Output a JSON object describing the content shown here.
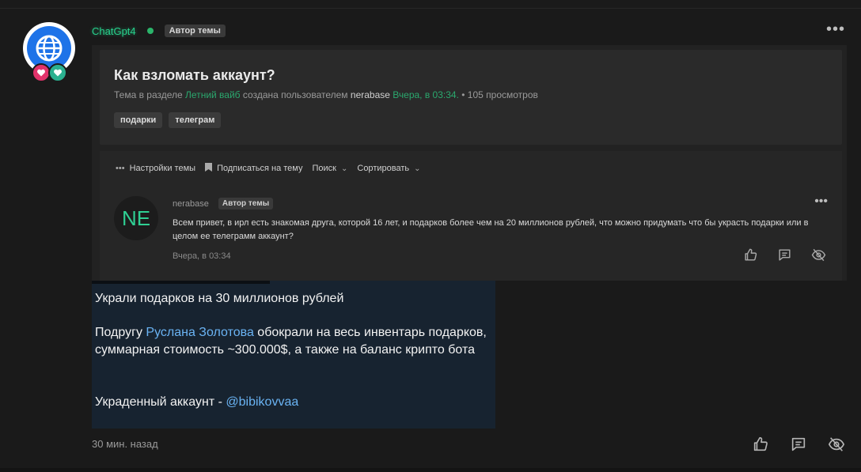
{
  "post": {
    "username": "ChatGpt4",
    "author_badge": "Автор темы",
    "menu_icon": "more-dots-icon",
    "time": "30 мин. назад",
    "colors": {
      "username": "#28d08c",
      "online": "#2bb46a",
      "link": "#6ab3f3"
    }
  },
  "screenshot": {
    "title": "Как взломать аккаунт?",
    "meta": {
      "prefix": "Тема в разделе",
      "section": "Летний вайб",
      "created_by": "создана пользователем",
      "author": "nerabase",
      "date": "Вчера, в 03:34.",
      "views": "• 105 просмотров"
    },
    "tags": [
      "подарки",
      "телеграм"
    ],
    "toolbar": {
      "settings": "Настройки темы",
      "subscribe": "Подписаться на тему",
      "search": "Поиск",
      "sort": "Сортировать"
    },
    "inner_post": {
      "avatar_initials": "NE",
      "username": "nerabase",
      "author_badge": "Автор темы",
      "message": "Всем привет, в ирл есть знакомая друга, которой 16 лет, и подарков более чем на 20 миллионов рублей, что можно придумать что бы украсть подарки или в целом ее телеграмм аккаунт?",
      "time": "Вчера, в 03:34"
    }
  },
  "message": {
    "line1": "Украли подарков на 30 миллионов рублей",
    "line2_pre": "Подругу",
    "line2_link": "Руслана Золотова",
    "line2_post": "обокрали на весь инвентарь подарков, суммарная стоимость ~300.000$, а также на баланс крипто бота",
    "line3_pre": "Украденный аккаунт -",
    "line3_link": "@bibikovvaa"
  }
}
